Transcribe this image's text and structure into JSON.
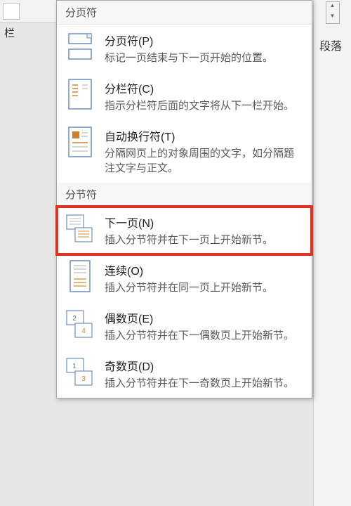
{
  "left_label": "栏",
  "right_label": "段落",
  "sections": [
    {
      "header": "分页符",
      "items": [
        {
          "title": "分页符(P)",
          "desc": "标记一页结束与下一页开始的位置。",
          "icon": "page-break-icon"
        },
        {
          "title": "分栏符(C)",
          "desc": "指示分栏符后面的文字将从下一栏开始。",
          "icon": "column-break-icon"
        },
        {
          "title": "自动换行符(T)",
          "desc": "分隔网页上的对象周围的文字，如分隔题注文字与正文。",
          "icon": "text-wrap-break-icon"
        }
      ]
    },
    {
      "header": "分节符",
      "items": [
        {
          "title": "下一页(N)",
          "desc": "插入分节符并在下一页上开始新节。",
          "icon": "next-page-icon",
          "highlighted": true
        },
        {
          "title": "连续(O)",
          "desc": "插入分节符并在同一页上开始新节。",
          "icon": "continuous-icon"
        },
        {
          "title": "偶数页(E)",
          "desc": "插入分节符并在下一偶数页上开始新节。",
          "icon": "even-page-icon"
        },
        {
          "title": "奇数页(D)",
          "desc": "插入分节符并在下一奇数页上开始新节。",
          "icon": "odd-page-icon"
        }
      ]
    }
  ]
}
